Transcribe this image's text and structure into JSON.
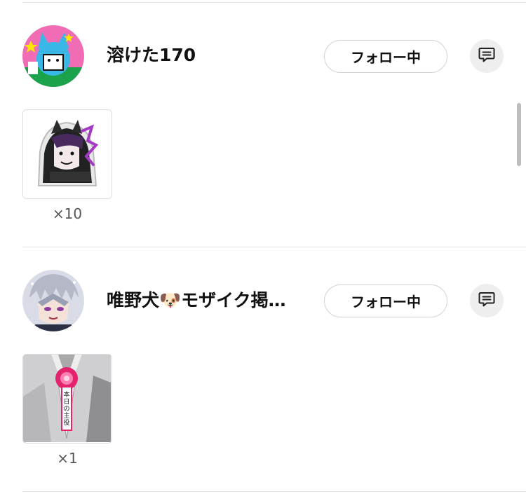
{
  "entries": [
    {
      "name": "溶けた170",
      "follow_label": "フォロー中",
      "message_icon": "message-icon",
      "sticker_count": "×10"
    },
    {
      "name": "唯野犬🐶モザイク掲…",
      "follow_label": "フォロー中",
      "message_icon": "message-icon",
      "sticker_count": "×1",
      "sticker_ribbon_text": "本日の主役"
    }
  ],
  "colors": {
    "divider": "#e3e3e3",
    "follow_border": "#d2d2d2",
    "message_bg": "#eeeeee",
    "count_text": "#555555"
  }
}
